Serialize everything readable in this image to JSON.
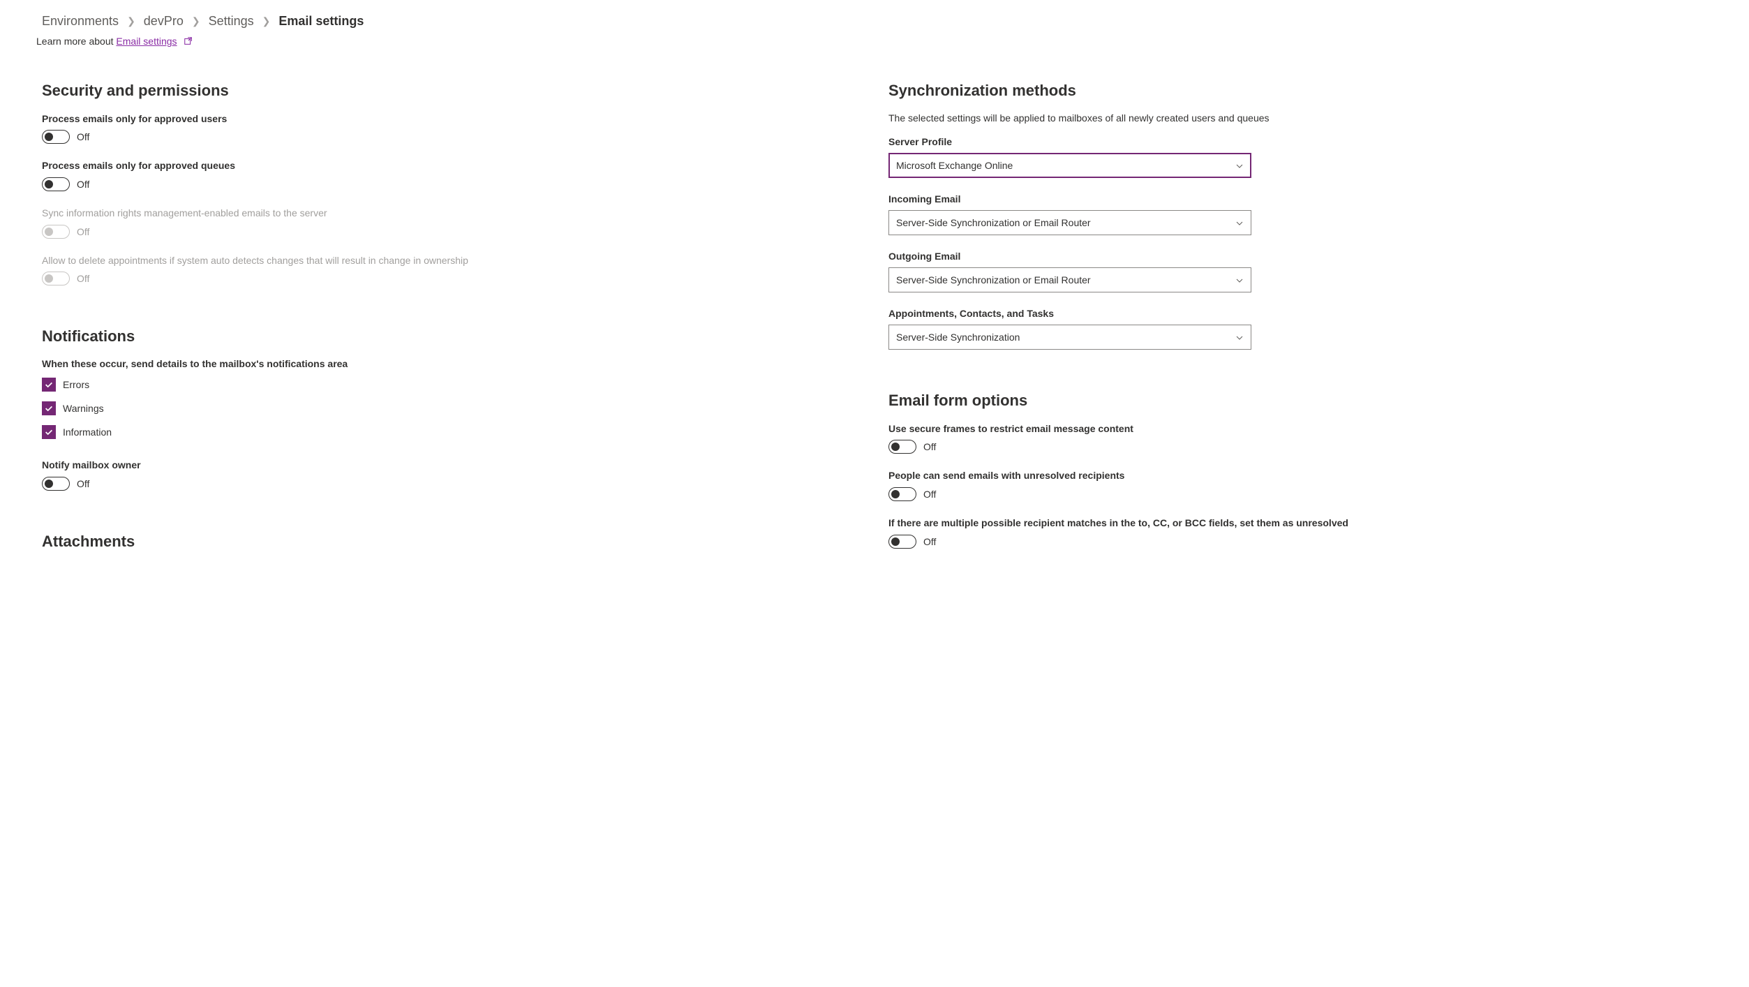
{
  "breadcrumb": {
    "items": [
      "Environments",
      "devPro",
      "Settings",
      "Email settings"
    ]
  },
  "learn_more": {
    "prefix": "Learn more about ",
    "link_text": "Email settings"
  },
  "left": {
    "security": {
      "title": "Security and permissions",
      "approved_users": {
        "label": "Process emails only for approved users",
        "state": "Off"
      },
      "approved_queues": {
        "label": "Process emails only for approved queues",
        "state": "Off"
      },
      "sync_irm": {
        "label": "Sync information rights management-enabled emails to the server",
        "state": "Off"
      },
      "allow_delete": {
        "label": "Allow to delete appointments if system auto detects changes that will result in change in ownership",
        "state": "Off"
      }
    },
    "notifications": {
      "title": "Notifications",
      "when_occur": "When these occur, send details to the mailbox's notifications area",
      "errors": "Errors",
      "warnings": "Warnings",
      "information": "Information",
      "notify_owner": {
        "label": "Notify mailbox owner",
        "state": "Off"
      }
    },
    "attachments": {
      "title": "Attachments"
    }
  },
  "right": {
    "sync": {
      "title": "Synchronization methods",
      "desc": "The selected settings will be applied to mailboxes of all newly created users and queues",
      "server_profile": {
        "label": "Server Profile",
        "value": "Microsoft Exchange Online"
      },
      "incoming": {
        "label": "Incoming Email",
        "value": "Server-Side Synchronization or Email Router"
      },
      "outgoing": {
        "label": "Outgoing Email",
        "value": "Server-Side Synchronization or Email Router"
      },
      "appts": {
        "label": "Appointments, Contacts, and Tasks",
        "value": "Server-Side Synchronization"
      }
    },
    "form": {
      "title": "Email form options",
      "secure_frames": {
        "label": "Use secure frames to restrict email message content",
        "state": "Off"
      },
      "unresolved": {
        "label": "People can send emails with unresolved recipients",
        "state": "Off"
      },
      "multi_match": {
        "label": "If there are multiple possible recipient matches in the to, CC, or BCC fields, set them as unresolved",
        "state": "Off"
      }
    }
  }
}
